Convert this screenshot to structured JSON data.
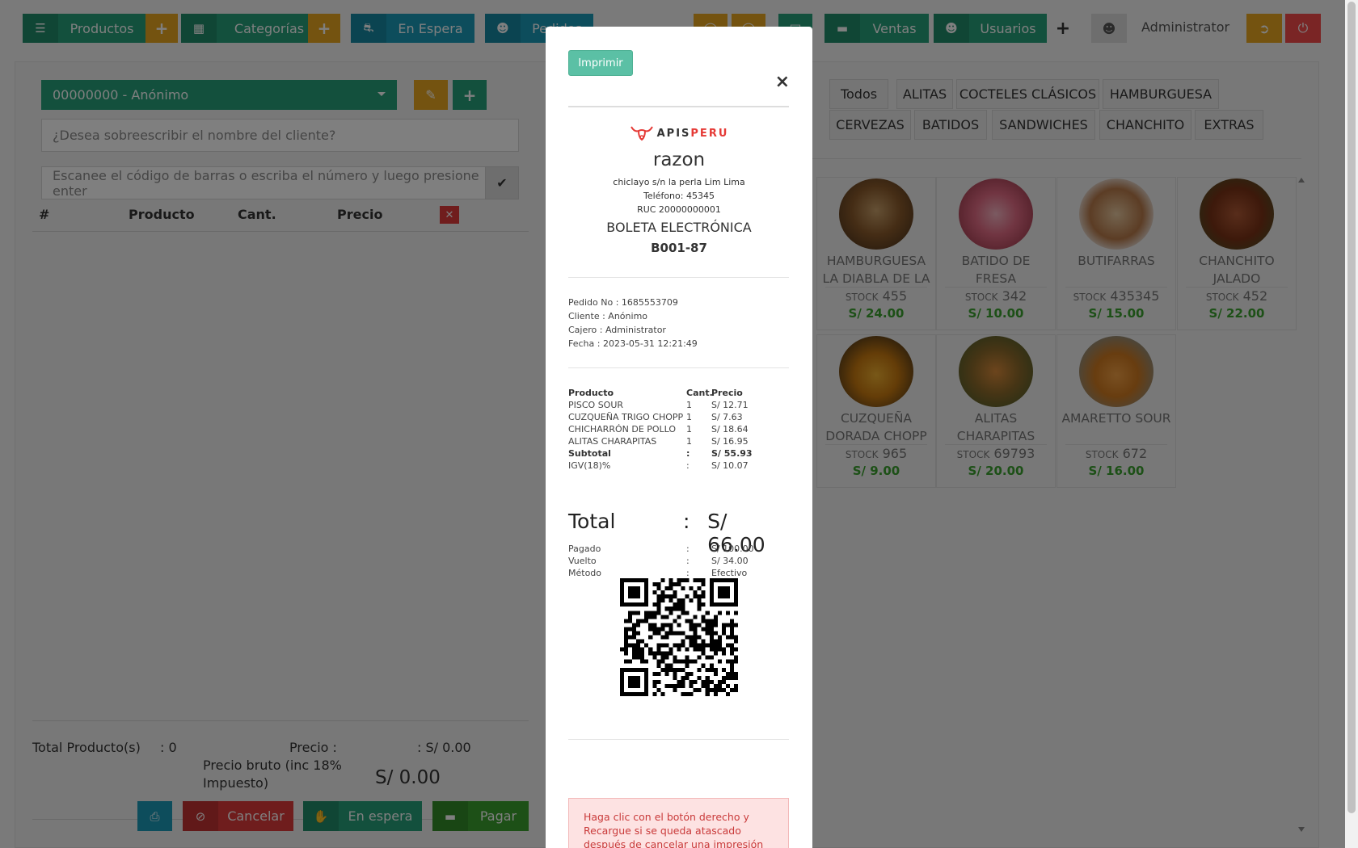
{
  "nav": {
    "productos": "Productos",
    "categorias": "Categorías",
    "en_espera": "En Espera",
    "pedidos": "Pedidos",
    "ventas": "Ventas",
    "usuarios": "Usuarios",
    "user_name": "Administrator"
  },
  "pos": {
    "client_select": "00000000 - Anónimo",
    "client_name_placeholder": "¿Desea sobreescribir el nombre del cliente?",
    "barcode_placeholder": "Escanee el código de barras o escriba el número y luego presione enter",
    "table_headers": {
      "num": "#",
      "producto": "Producto",
      "cant": "Cant.",
      "precio": "Precio"
    },
    "total_productos_label": "Total Producto(s)",
    "total_productos_value": ": 0",
    "precio_label": "Precio :",
    "precio_value": ": S/ 0.00",
    "precio_bruto_label": "Precio bruto (inc 18% Impuesto)",
    "precio_bruto_value": "S/ 0.00",
    "buttons": {
      "cancelar": "Cancelar",
      "en_espera": "En espera",
      "pagar": "Pagar"
    }
  },
  "categories": [
    "Todos",
    "ALITAS",
    "COCTELES CLÁSICOS",
    "HAMBURGUESA",
    "CERVEZAS",
    "BATIDOS",
    "SANDWICHES",
    "CHANCHITO",
    "EXTRAS"
  ],
  "products": [
    {
      "name": "HAMBURGUESA LA DIABLA DE LA",
      "stock_label": "STOCK",
      "stock": "455",
      "price": "S/ 24.00"
    },
    {
      "name": "BATIDO DE FRESA",
      "stock_label": "STOCK",
      "stock": "342",
      "price": "S/ 10.00"
    },
    {
      "name": "BUTIFARRAS",
      "stock_label": "STOCK",
      "stock": "435345",
      "price": "S/ 15.00"
    },
    {
      "name": "CHANCHITO JALADO",
      "stock_label": "STOCK",
      "stock": "452",
      "price": "S/ 22.00"
    },
    {
      "name": "CUZQUEÑA DORADA CHOPP",
      "stock_label": "STOCK",
      "stock": "965",
      "price": "S/ 9.00"
    },
    {
      "name": "ALITAS CHARAPITAS",
      "stock_label": "STOCK",
      "stock": "69793",
      "price": "S/ 20.00"
    },
    {
      "name": "AMARETTO SOUR",
      "stock_label": "STOCK",
      "stock": "672",
      "price": "S/ 16.00"
    }
  ],
  "receipt": {
    "print_button": "Imprimir",
    "close": "×",
    "logo_a": "APIS",
    "logo_b": "PERU",
    "business": "razon",
    "address": "chiclayo s/n la perla Lim Lima",
    "phone": "Teléfono: 45345",
    "ruc": "RUC 20000000001",
    "doc_type": "BOLETA ELECTRÓNICA",
    "doc_number": "B001-87",
    "pedido": "Pedido No : 1685553709",
    "cliente": "Cliente : Anónimo",
    "cajero": "Cajero : Administrator",
    "fecha": "Fecha : 2023-05-31 12:21:49",
    "headers": {
      "producto": "Producto",
      "cant": "Cant.",
      "precio": "Precio"
    },
    "items": [
      {
        "name": "PISCO SOUR",
        "qty": "1",
        "price": "S/ 12.71"
      },
      {
        "name": "CUZQUEÑA TRIGO CHOPP",
        "qty": "1",
        "price": "S/ 7.63"
      },
      {
        "name": "CHICHARRÓN DE POLLO",
        "qty": "1",
        "price": "S/ 18.64"
      },
      {
        "name": "ALITAS CHARAPITAS",
        "qty": "1",
        "price": "S/ 16.95"
      }
    ],
    "subtotal_label": "Subtotal",
    "subtotal": "S/ 55.93",
    "igv_label": "IGV(18)%",
    "igv": "S/ 10.07",
    "colon": ":",
    "total_label": "Total",
    "total": "S/ 66.00",
    "pagado_label": "Pagado",
    "pagado": "S/ 100.00",
    "vuelto_label": "Vuelto",
    "vuelto": "S/ 34.00",
    "metodo_label": "Método",
    "metodo": "Efectivo",
    "alert": "Haga clic con el botón derecho y Recargue si se queda atascado después de cancelar una impresión"
  }
}
